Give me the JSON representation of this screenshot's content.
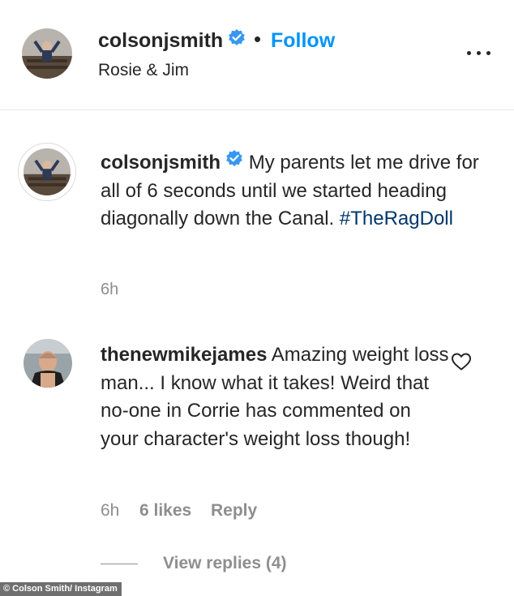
{
  "header": {
    "username": "colsonjsmith",
    "separator": "•",
    "follow_label": "Follow",
    "location": "Rosie & Jim",
    "more_icon": "more-horizontal-icon"
  },
  "caption": {
    "username": "colsonjsmith",
    "text": "My parents let me drive for all of 6 seconds until we started heading diagonally down the Canal.",
    "hashtag": "#TheRagDoll",
    "time": "6h"
  },
  "comment": {
    "username": "thenewmikejames",
    "text": "Amazing weight loss man... I know what it takes! Weird that no-one in Corrie has commented on your character's weight loss though!",
    "time": "6h",
    "likes": "6 likes",
    "reply_label": "Reply",
    "view_replies": "View replies (4)"
  },
  "credit": "© Colson Smith/ Instagram",
  "colors": {
    "follow": "#0095f6",
    "hashtag": "#00376b",
    "verified": "#3897f0",
    "muted": "#8e8e8e"
  }
}
